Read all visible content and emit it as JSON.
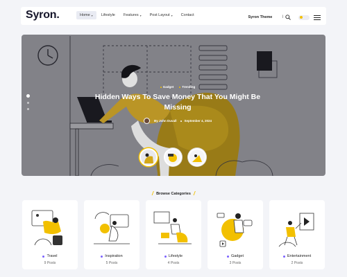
{
  "header": {
    "logo": "Syron.",
    "nav": [
      {
        "label": "Home",
        "chevron": true
      },
      {
        "label": "Lifestyle",
        "chevron": false
      },
      {
        "label": "Features",
        "chevron": true
      },
      {
        "label": "Post Layout",
        "chevron": true
      },
      {
        "label": "Contact",
        "chevron": false
      }
    ],
    "theme_link": "Syron Theme",
    "separator": "I",
    "icons": [
      "search-icon",
      "dark-mode-toggle",
      "hamburger-menu-icon"
    ]
  },
  "hero": {
    "tags": [
      "Gadget",
      "Trending"
    ],
    "title": "Hidden Ways To Save Money That You Might Be Missing",
    "author": "By John Duvall",
    "date": "September 4, 2024",
    "slides": 3,
    "active_slide": 1
  },
  "browse": {
    "heading": "Browse Categories",
    "categories": [
      {
        "name": "Travel",
        "posts": "9 Posts"
      },
      {
        "name": "Inspiration",
        "posts": "5 Posts"
      },
      {
        "name": "Lifestyle",
        "posts": "4 Posts"
      },
      {
        "name": "Gadget",
        "posts": "3 Posts"
      },
      {
        "name": "Entertainment",
        "posts": "2 Posts"
      }
    ]
  },
  "colors": {
    "accent": "#f2c000",
    "bullet": "#7b61ff",
    "hero_bg": "#8e8e94"
  }
}
